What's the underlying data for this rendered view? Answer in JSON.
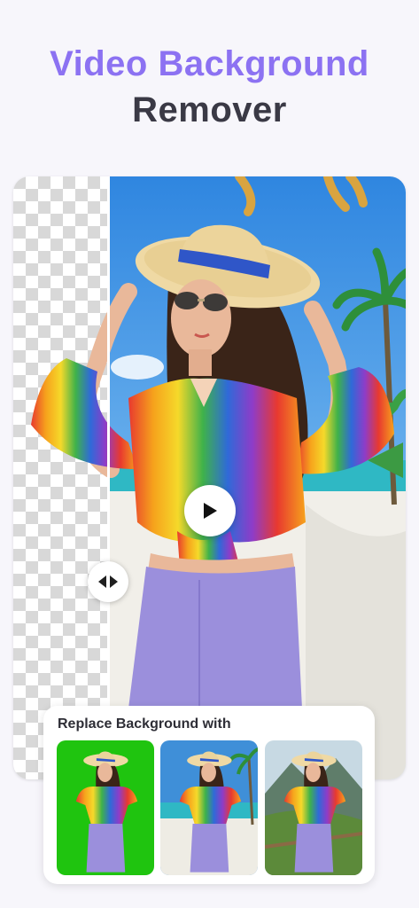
{
  "headline": {
    "line1": "Video Background",
    "line2": "Remover"
  },
  "preview": {
    "subject": "woman in striped shirt and sun hat on beach",
    "compare_handle_icon": "arrows-left-right-icon",
    "play_icon": "play-icon"
  },
  "replace_panel": {
    "title": "Replace Background with",
    "options": [
      {
        "name": "Green screen",
        "color": "#1fc40f"
      },
      {
        "name": "Beach",
        "color": "#3f8fd8"
      },
      {
        "name": "Mountains",
        "color": "#5c8a3a"
      }
    ]
  },
  "colors": {
    "accent": "#8c72f2",
    "text_dark": "#3a3945"
  }
}
